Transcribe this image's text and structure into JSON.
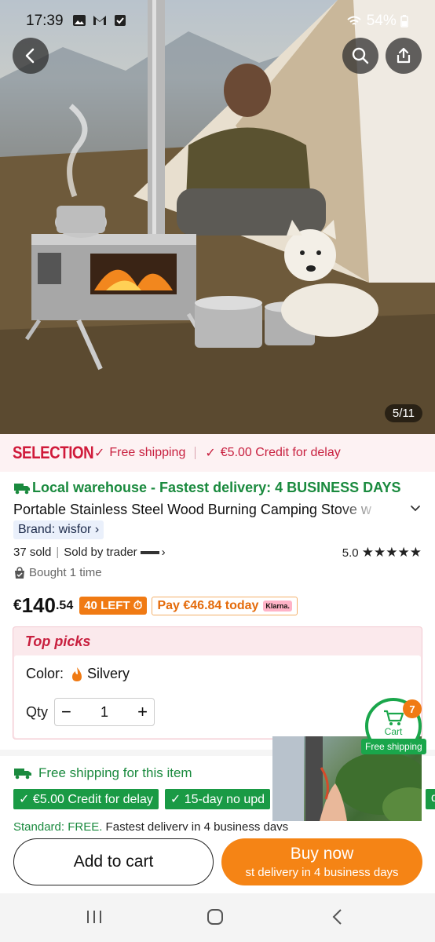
{
  "status_bar": {
    "time": "17:39",
    "icons": [
      "image-icon",
      "gmail-icon",
      "check-box-icon"
    ],
    "battery": "54%"
  },
  "hero": {
    "image_description_icon": "product-photo",
    "page_indicator": "5/11"
  },
  "selection_bar": {
    "logo": "SELECTION",
    "items": [
      "Free shipping",
      "€5.00 Credit for delay"
    ]
  },
  "product": {
    "warehouse": "Local warehouse - Fastest delivery: 4 BUSINESS DAYS",
    "title": "Portable Stainless Steel Wood Burning Camping Stove w",
    "brand": "Brand: wisfor",
    "sold": "37 sold",
    "sold_by": "Sold by trader",
    "rating": "5.0",
    "stars": "★★★★★",
    "bought": "Bought 1 time",
    "price": {
      "currency": "€",
      "integer": "140",
      "decimal": ".54"
    },
    "stock_badge": "40 LEFT",
    "pay_later": "Pay €46.84 today",
    "klarna": "Klarna."
  },
  "top_picks": {
    "title": "Top picks",
    "color_label": "Color:",
    "color_value": "Silvery",
    "qty_label": "Qty",
    "qty_value": "1",
    "minus": "−",
    "plus": "+"
  },
  "cart": {
    "label": "Cart",
    "count": "7",
    "free_shipping": "Free shipping"
  },
  "shipping": {
    "title": "Free shipping for this item",
    "tags": [
      "€5.00 Credit for delay",
      "15-day no upd"
    ],
    "tag_partial": "de",
    "standard_label": "Standard: FREE.",
    "standard_rest": " Fastest delivery in 4 business days"
  },
  "actions": {
    "add_to_cart": "Add to cart",
    "buy_now": "Buy now",
    "buy_now_sub": "st delivery in 4 business days"
  },
  "colors": {
    "selection_red": "#d01a3a",
    "green": "#1a8a3e",
    "orange": "#f58415"
  }
}
